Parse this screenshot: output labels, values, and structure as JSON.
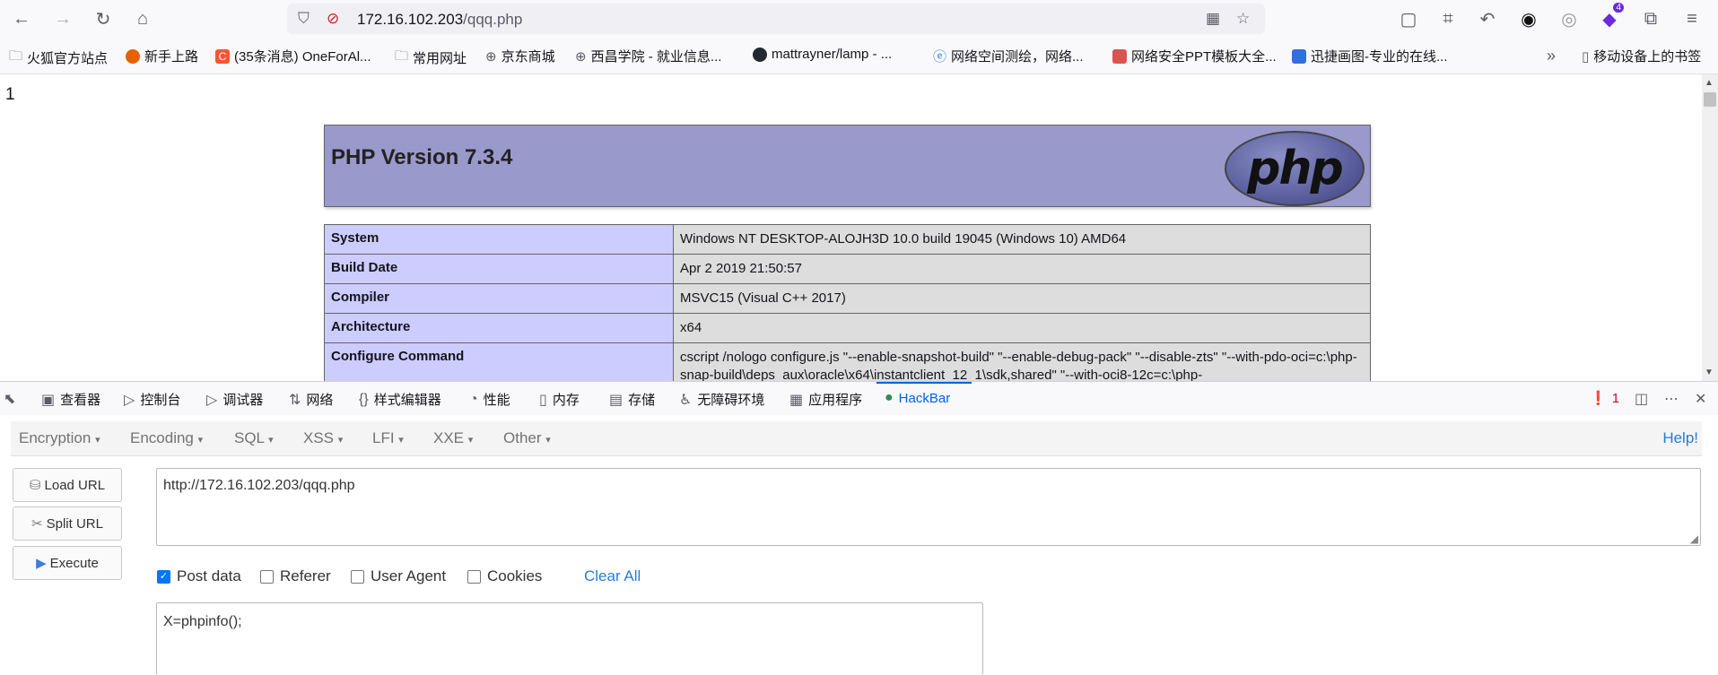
{
  "browser": {
    "url_host": "172.16.102.203",
    "url_path": "/qqq.php",
    "bookmarks": [
      "火狐官方站点",
      "新手上路",
      "(35条消息) OneForAl...",
      "常用网址",
      "京东商城",
      "西昌学院 - 就业信息...",
      "mattrayner/lamp - ...",
      "网络空间测绘，网络...",
      "网络安全PPT模板大全...",
      "迅捷画图-专业的在线...",
      "移动设备上的书签"
    ],
    "ext_badge": "4"
  },
  "page": {
    "output_line": "1",
    "php_title": "PHP Version 7.3.4",
    "logo_text": "php",
    "rows": [
      {
        "key": "System",
        "value": "Windows NT DESKTOP-ALOJH3D 10.0 build 19045 (Windows 10) AMD64"
      },
      {
        "key": "Build Date",
        "value": "Apr 2 2019 21:50:57"
      },
      {
        "key": "Compiler",
        "value": "MSVC15 (Visual C++ 2017)"
      },
      {
        "key": "Architecture",
        "value": "x64"
      },
      {
        "key": "Configure Command",
        "value": "cscript /nologo configure.js \"--enable-snapshot-build\" \"--enable-debug-pack\" \"--disable-zts\" \"--with-pdo-oci=c:\\php-snap-build\\deps_aux\\oracle\\x64\\instantclient_12_1\\sdk,shared\" \"--with-oci8-12c=c:\\php-"
      }
    ]
  },
  "devtools": {
    "tabs": [
      "查看器",
      "控制台",
      "调试器",
      "网络",
      "样式编辑器",
      "性能",
      "内存",
      "存储",
      "无障碍环境",
      "应用程序",
      "HackBar"
    ],
    "error_count": "1"
  },
  "hackbar": {
    "menu": [
      "Encryption",
      "Encoding",
      "SQL",
      "XSS",
      "LFI",
      "XXE",
      "Other"
    ],
    "help": "Help!",
    "buttons": [
      "Load URL",
      "Split URL",
      "Execute"
    ],
    "url_value": "http://172.16.102.203/qqq.php",
    "options": [
      {
        "label": "Post data",
        "checked": true
      },
      {
        "label": "Referer",
        "checked": false
      },
      {
        "label": "User Agent",
        "checked": false
      },
      {
        "label": "Cookies",
        "checked": false
      }
    ],
    "clear_all": "Clear All",
    "post_value": "X=phpinfo();"
  }
}
